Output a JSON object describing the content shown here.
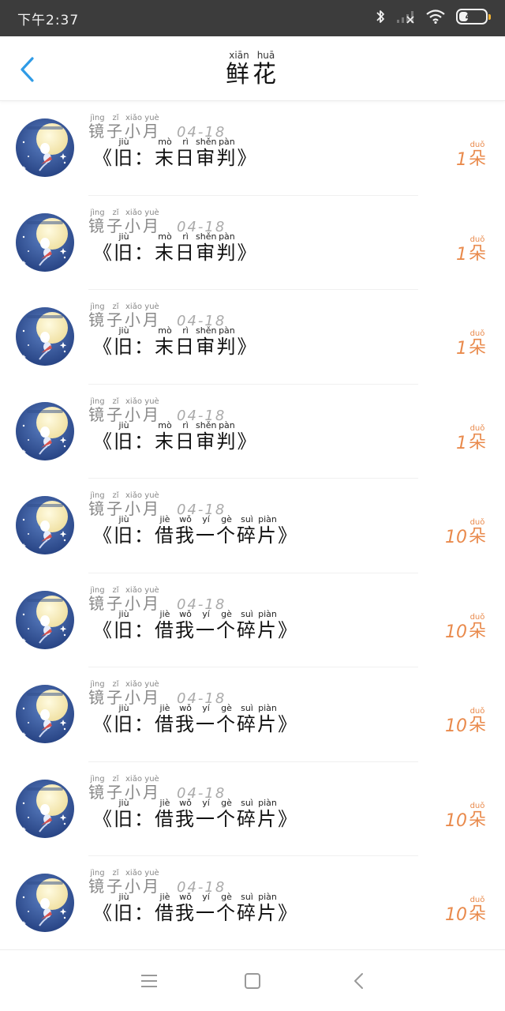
{
  "status_bar": {
    "time": "下午2:37",
    "battery": "43",
    "battery_level": 0.43,
    "icons": [
      "bluetooth-icon",
      "signal-icon",
      "wifi-icon",
      "battery-icon"
    ]
  },
  "header": {
    "title": "鲜花",
    "title_pinyin": [
      "xiān",
      "huā"
    ],
    "back_icon": "chevron-left-icon"
  },
  "colors": {
    "accent": "#2f9be6",
    "count": "#e98a4c",
    "status_bg": "#3c3c3c"
  },
  "items": [
    {
      "sender": "镜子小月",
      "sender_pinyin": [
        "jìng",
        "zǐ",
        "xiǎo",
        "yuè"
      ],
      "date": "04-18",
      "title_pre": "《旧：",
      "title_main": "末日审判",
      "title_pinyin": [
        "mò",
        "rì",
        "shěn",
        "pàn"
      ],
      "title_post": "》",
      "count": "1",
      "unit": "朵",
      "unit_pinyin": "duǒ"
    },
    {
      "sender": "镜子小月",
      "sender_pinyin": [
        "jìng",
        "zǐ",
        "xiǎo",
        "yuè"
      ],
      "date": "04-18",
      "title_pre": "《旧：",
      "title_main": "末日审判",
      "title_pinyin": [
        "mò",
        "rì",
        "shěn",
        "pàn"
      ],
      "title_post": "》",
      "count": "1",
      "unit": "朵",
      "unit_pinyin": "duǒ"
    },
    {
      "sender": "镜子小月",
      "sender_pinyin": [
        "jìng",
        "zǐ",
        "xiǎo",
        "yuè"
      ],
      "date": "04-18",
      "title_pre": "《旧：",
      "title_main": "末日审判",
      "title_pinyin": [
        "mò",
        "rì",
        "shěn",
        "pàn"
      ],
      "title_post": "》",
      "count": "1",
      "unit": "朵",
      "unit_pinyin": "duǒ"
    },
    {
      "sender": "镜子小月",
      "sender_pinyin": [
        "jìng",
        "zǐ",
        "xiǎo",
        "yuè"
      ],
      "date": "04-18",
      "title_pre": "《旧：",
      "title_main": "末日审判",
      "title_pinyin": [
        "mò",
        "rì",
        "shěn",
        "pàn"
      ],
      "title_post": "》",
      "count": "1",
      "unit": "朵",
      "unit_pinyin": "duǒ"
    },
    {
      "sender": "镜子小月",
      "sender_pinyin": [
        "jìng",
        "zǐ",
        "xiǎo",
        "yuè"
      ],
      "date": "04-18",
      "title_pre": "《旧：",
      "title_main": "借我一个碎片",
      "title_pinyin": [
        "jiè",
        "wǒ",
        "yí",
        "gè",
        "suì",
        "piàn"
      ],
      "title_post": "》",
      "count": "10",
      "unit": "朵",
      "unit_pinyin": "duǒ"
    },
    {
      "sender": "镜子小月",
      "sender_pinyin": [
        "jìng",
        "zǐ",
        "xiǎo",
        "yuè"
      ],
      "date": "04-18",
      "title_pre": "《旧：",
      "title_main": "借我一个碎片",
      "title_pinyin": [
        "jiè",
        "wǒ",
        "yí",
        "gè",
        "suì",
        "piàn"
      ],
      "title_post": "》",
      "count": "10",
      "unit": "朵",
      "unit_pinyin": "duǒ"
    },
    {
      "sender": "镜子小月",
      "sender_pinyin": [
        "jìng",
        "zǐ",
        "xiǎo",
        "yuè"
      ],
      "date": "04-18",
      "title_pre": "《旧：",
      "title_main": "借我一个碎片",
      "title_pinyin": [
        "jiè",
        "wǒ",
        "yí",
        "gè",
        "suì",
        "piàn"
      ],
      "title_post": "》",
      "count": "10",
      "unit": "朵",
      "unit_pinyin": "duǒ"
    },
    {
      "sender": "镜子小月",
      "sender_pinyin": [
        "jìng",
        "zǐ",
        "xiǎo",
        "yuè"
      ],
      "date": "04-18",
      "title_pre": "《旧：",
      "title_main": "借我一个碎片",
      "title_pinyin": [
        "jiè",
        "wǒ",
        "yí",
        "gè",
        "suì",
        "piàn"
      ],
      "title_post": "》",
      "count": "10",
      "unit": "朵",
      "unit_pinyin": "duǒ"
    },
    {
      "sender": "镜子小月",
      "sender_pinyin": [
        "jìng",
        "zǐ",
        "xiǎo",
        "yuè"
      ],
      "date": "04-18",
      "title_pre": "《旧：",
      "title_main": "借我一个碎片",
      "title_pinyin": [
        "jiè",
        "wǒ",
        "yí",
        "gè",
        "suì",
        "piàn"
      ],
      "title_post": "》",
      "count": "10",
      "unit": "朵",
      "unit_pinyin": "duǒ"
    }
  ],
  "nav_bar": {
    "icons": [
      "menu-icon",
      "home-square-icon",
      "back-triangle-icon"
    ]
  }
}
